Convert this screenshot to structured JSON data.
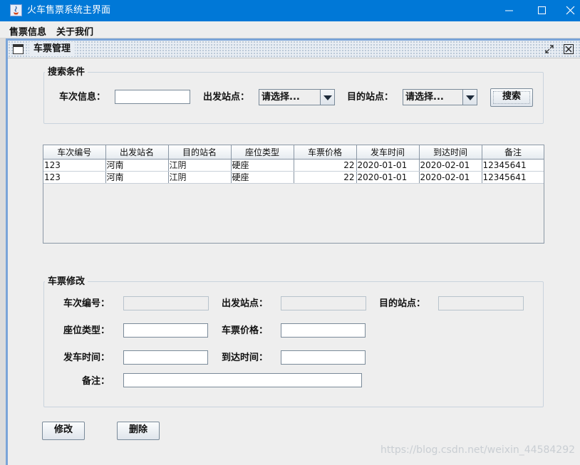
{
  "window": {
    "title": "火车售票系统主界面"
  },
  "menubar": {
    "items": [
      "售票信息",
      "关于我们"
    ]
  },
  "internal_frame": {
    "title": "车票管理"
  },
  "search": {
    "group_title": "搜索条件",
    "train_label": "车次信息：",
    "train_value": "",
    "from_label": "出发站点：",
    "from_value": "请选择...",
    "to_label": "目的站点：",
    "to_value": "请选择...",
    "search_button": "搜索"
  },
  "table": {
    "columns": [
      "车次编号",
      "出发站名",
      "目的站名",
      "座位类型",
      "车票价格",
      "发车时间",
      "到达时间",
      "备注"
    ],
    "rows": [
      [
        "123",
        "河南",
        "江阴",
        "硬座",
        "22",
        "2020-01-01",
        "2020-02-01",
        "12345641"
      ],
      [
        "123",
        "河南",
        "江阴",
        "硬座",
        "22",
        "2020-01-01",
        "2020-02-01",
        "12345641"
      ]
    ]
  },
  "edit": {
    "group_title": "车票修改",
    "train_no_label": "车次编号：",
    "from_label": "出发站点：",
    "to_label": "目的站点：",
    "seat_label": "座位类型：",
    "price_label": "车票价格：",
    "depart_label": "发车时间：",
    "arrive_label": "到达时间：",
    "note_label": "备注：",
    "values": {
      "train_no": "",
      "from": "",
      "to": "",
      "seat": "",
      "price": "",
      "depart": "",
      "arrive": "",
      "note": ""
    }
  },
  "actions": {
    "modify": "修改",
    "delete": "删除"
  },
  "watermark": "https://blog.csdn.net/weixin_44584292"
}
